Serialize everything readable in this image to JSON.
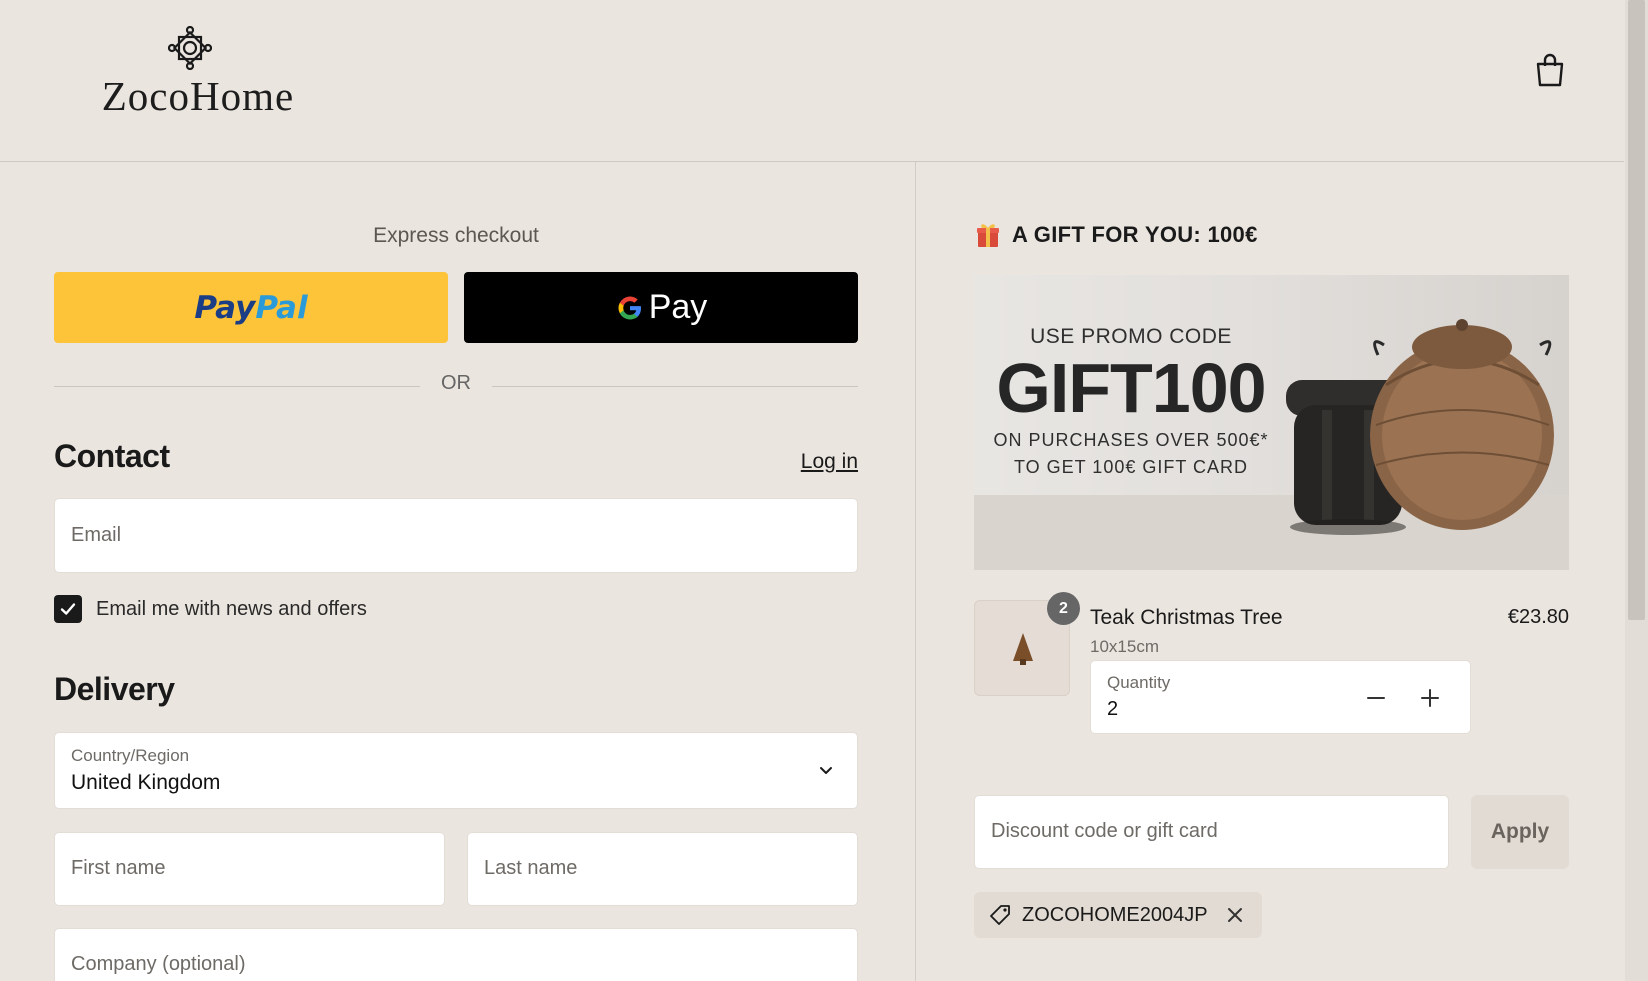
{
  "brand": {
    "name": "ZocoHome"
  },
  "header": {
    "cart_icon": "shopping-bag-icon"
  },
  "express": {
    "label": "Express checkout",
    "paypal_a": "Pay",
    "paypal_b": "Pal",
    "gpay_label": "Pay",
    "divider": "OR"
  },
  "contact": {
    "heading": "Contact",
    "login_link": "Log in",
    "email_placeholder": "Email",
    "newsletter_label": "Email me with news and offers",
    "newsletter_checked": true
  },
  "delivery": {
    "heading": "Delivery",
    "country_label": "Country/Region",
    "country_value": "United Kingdom",
    "first_name_placeholder": "First name",
    "last_name_placeholder": "Last name",
    "company_placeholder": "Company (optional)"
  },
  "promo": {
    "heading": "A GIFT FOR YOU: 100€",
    "line1": "USE PROMO CODE",
    "code": "GIFT100",
    "line3": "ON PURCHASES OVER 500€*",
    "line4": "TO GET 100€ GIFT CARD"
  },
  "cart": {
    "items": [
      {
        "name": "Teak Christmas Tree",
        "variant": "10x15cm",
        "price": "€23.80",
        "badge": "2",
        "quantity_label": "Quantity",
        "quantity": "2"
      }
    ]
  },
  "discount": {
    "placeholder": "Discount code or gift card",
    "apply_label": "Apply",
    "applied_code": "ZOCOHOME2004JP"
  },
  "colors": {
    "paypal": "#fdc43a",
    "gpay": "#000000",
    "background": "#ebe5df"
  }
}
